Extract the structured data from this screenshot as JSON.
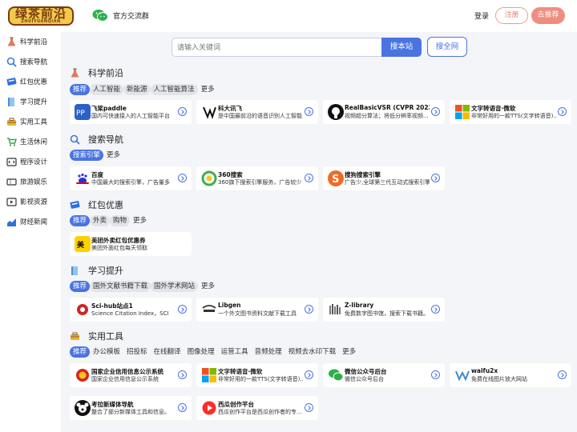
{
  "header": {
    "logo_text": "绿茶前沿",
    "logo_sub": "ZHUIYUANQIAN",
    "group_label": "官方交流群",
    "login_label": "登录",
    "register_label": "注册",
    "recommend_label": "去推荐"
  },
  "sidebar": {
    "items": [
      {
        "label": "科学前沿",
        "icon": "flask-icon"
      },
      {
        "label": "搜索导航",
        "icon": "search-icon"
      },
      {
        "label": "红包优惠",
        "icon": "coupon-icon"
      },
      {
        "label": "学习提升",
        "icon": "book-icon"
      },
      {
        "label": "实用工具",
        "icon": "toolbox-icon"
      },
      {
        "label": "生活休闲",
        "icon": "cart-icon"
      },
      {
        "label": "程序设计",
        "icon": "code-icon"
      },
      {
        "label": "旅游娱乐",
        "icon": "ticket-icon"
      },
      {
        "label": "影视资源",
        "icon": "video-icon"
      },
      {
        "label": "财经新闻",
        "icon": "chart-icon"
      }
    ]
  },
  "search": {
    "placeholder": "请输入关键词",
    "site_button": "搜本站",
    "all_button": "搜全网"
  },
  "sections": [
    {
      "title": "科学前沿",
      "tabs": [
        "推荐",
        "人工智能",
        "新能源",
        "人工智能算法"
      ],
      "more": "更多",
      "cards": [
        {
          "name": "飞桨paddle",
          "desc": "国内可快速接入的人工智能平台"
        },
        {
          "name": "科大讯飞",
          "desc": "是中国最前沿的语音识别人工智能..."
        },
        {
          "name": "RealBasicVSR (CVPR 2022)",
          "desc": "视频超分算法；将低分辨率视频..."
        },
        {
          "name": "文字转语音·微软",
          "desc": "非常好用的一款TTS(文字转语音)..."
        }
      ]
    },
    {
      "title": "搜索导航",
      "tabs": [
        "搜索引擎"
      ],
      "more": "更多",
      "cards": [
        {
          "name": "百度",
          "desc": "中国最大的搜索引擎，广告量多"
        },
        {
          "name": "360搜索",
          "desc": "360旗下搜索引擎服务，广告较少"
        },
        {
          "name": "搜狗搜索引擎",
          "desc": "广告少,全球第三代互动式搜索引擎"
        }
      ]
    },
    {
      "title": "红包优惠",
      "tabs": [
        "推荐",
        "外卖",
        "购物"
      ],
      "more": "更多",
      "cards": [
        {
          "name": "美团外卖红包优惠券",
          "desc": "美团外面红包每天领取"
        }
      ]
    },
    {
      "title": "学习提升",
      "tabs": [
        "推荐",
        "国外文献书籍下载",
        "国外学术网站"
      ],
      "more": "更多",
      "cards": [
        {
          "name": "Sci-hub站点1",
          "desc": "Science Citation Index，SCI"
        },
        {
          "name": "Libgen",
          "desc": "一个外文图书资料文献下载工具"
        },
        {
          "name": "Z-library",
          "desc": "免费数字图书馆，搜索下载书籍。"
        }
      ]
    },
    {
      "title": "实用工具",
      "tabs": [
        "推荐",
        "办公模板",
        "招投标",
        "在线翻译",
        "图像处理",
        "运营工具",
        "音频处理",
        "视频去水印下载"
      ],
      "more": "更多",
      "cards": [
        {
          "name": "国家企业信用信息公示系统",
          "desc": "国家企业信用信息公示系统"
        },
        {
          "name": "文字转语音·微软",
          "desc": "非常好用的一款TTS(文字转语音)..."
        },
        {
          "name": "微信公众号后台",
          "desc": "微信公众号后台"
        },
        {
          "name": "waifu2x",
          "desc": "免费在线图片放大网站"
        },
        {
          "name": "考拉新媒体导航",
          "desc": "整合了部分新媒体工具和信息。"
        },
        {
          "name": "西瓜创作平台",
          "desc": "西瓜创作平台是西瓜创作者的专..."
        }
      ]
    }
  ],
  "colors": {
    "accent": "#4a74e0",
    "register": "#f07b68",
    "recommend_bg": "#f08d80",
    "page_bg": "#f4f5f8"
  }
}
